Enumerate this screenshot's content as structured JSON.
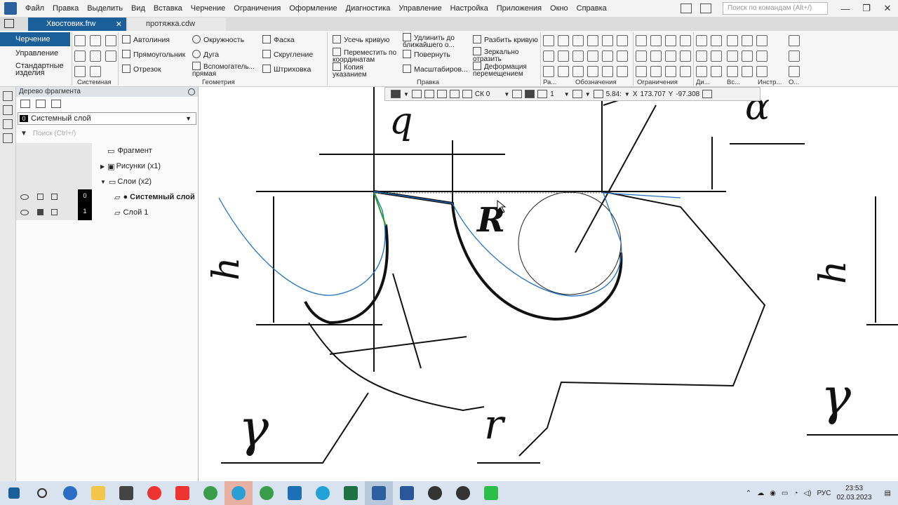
{
  "menu": [
    "Файл",
    "Правка",
    "Выделить",
    "Вид",
    "Вставка",
    "Черчение",
    "Ограничения",
    "Оформление",
    "Диагностика",
    "Управление",
    "Настройка",
    "Приложения",
    "Окно",
    "Справка"
  ],
  "command_search": {
    "placeholder": "Поиск по командам (Alt+/)"
  },
  "window_controls": {
    "minimize": "—",
    "restore": "❐",
    "close": "✕"
  },
  "tabs": [
    {
      "label": "Хвостовик.frw",
      "active": true,
      "close": "✕"
    },
    {
      "label": "протяжка.cdw",
      "active": false
    }
  ],
  "ribbon": {
    "modes": [
      "Черчение",
      "Управление",
      "Стандартные изделия"
    ],
    "systemnaya": {
      "group": "Системная"
    },
    "geometry": {
      "items": [
        "Автолиния",
        "Прямоугольник",
        "Отрезок",
        "Окружность",
        "Дуга",
        "Вспомогатель... прямая",
        "Фаска",
        "Скругление",
        "Штриховка"
      ],
      "group": "Геометрия"
    },
    "pravka": {
      "items": [
        "Усечь кривую",
        "Переместить по координатам",
        "Копия указанием",
        "Удлинить до ближайшего о...",
        "Повернуть",
        "Масштабиров...",
        "Разбить кривую",
        "Зеркально отразить",
        "Деформация перемещением"
      ],
      "group": "Правка"
    },
    "groups_right": [
      "Ра...",
      "Обозначения",
      "Ограничения",
      "Ди...",
      "Вс...",
      "Инстр...",
      "О..."
    ]
  },
  "tree": {
    "title": "Дерево фрагмента",
    "layer_select": {
      "num": "0",
      "label": "Системный слой"
    },
    "search_placeholder": "Поиск (Ctrl+/)",
    "root": "Фрагмент",
    "drawings": "Рисунки (x1)",
    "layers": "Слои (x2)",
    "layer_rows": [
      {
        "num": "0",
        "label": "● Системный слой"
      },
      {
        "num": "1",
        "label": "Слой 1"
      }
    ]
  },
  "floatbar": {
    "cs": "СК 0",
    "step": "1",
    "zoom": "5.84:",
    "x_label": "X",
    "x_value": "173.707",
    "y_label": "Y",
    "y_value": "-97.308"
  },
  "drawing_labels": {
    "q": "q",
    "alpha": "α",
    "h_left": "h",
    "h_right": "h",
    "r": "r",
    "gamma_left": "γ",
    "gamma_right": "γ",
    "R": "R"
  },
  "taskbar": {
    "lang": "РУС",
    "time": "23:53",
    "date": "02.03.2023"
  },
  "colors": {
    "accent": "#1a5e9a",
    "spline": "#1f6fc0",
    "green_seg": "#2aa02a"
  }
}
